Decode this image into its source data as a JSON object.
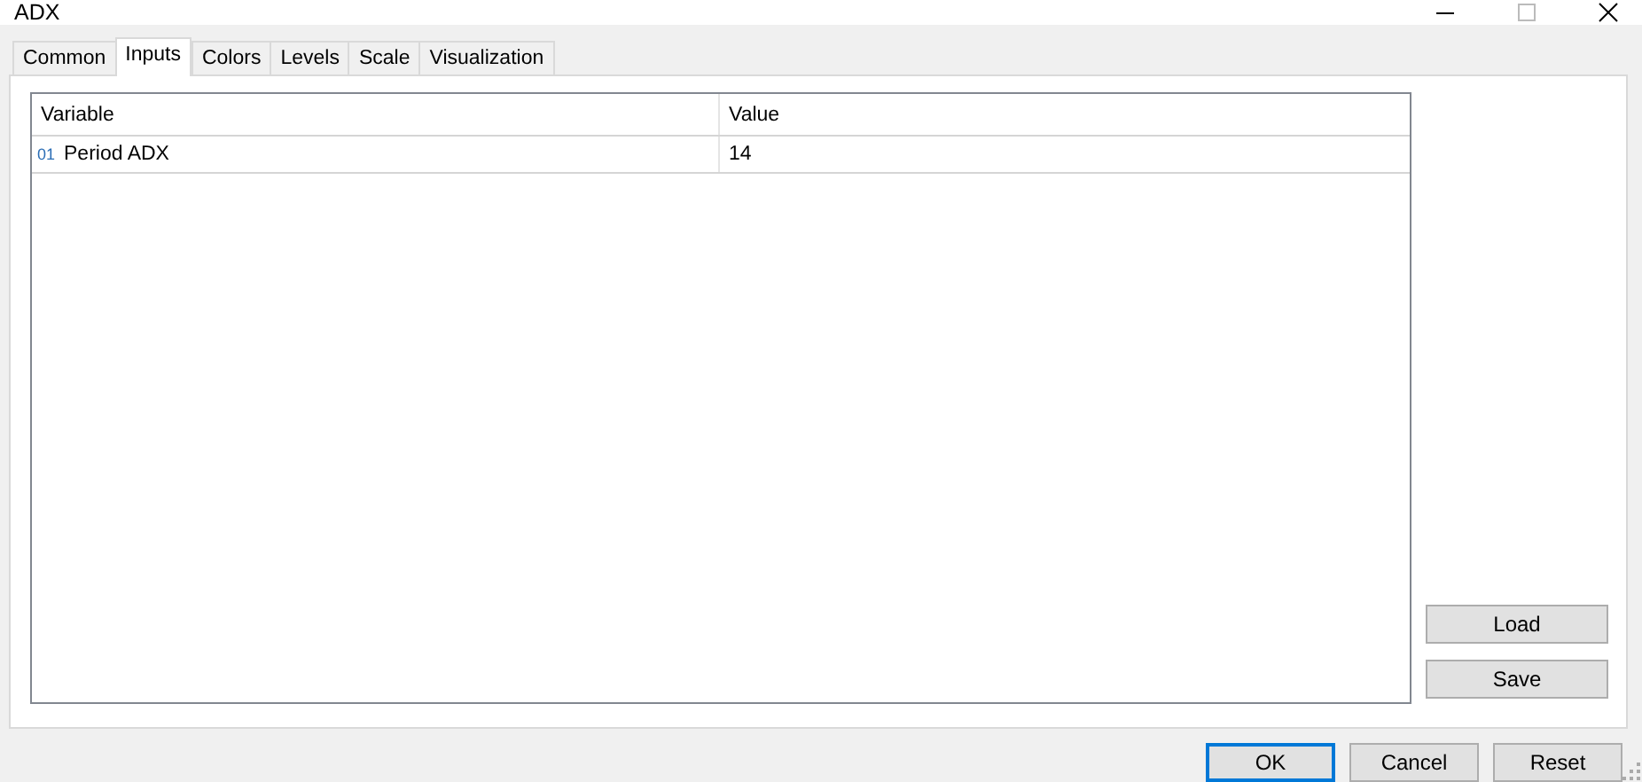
{
  "window": {
    "title": "ADX"
  },
  "tabs": [
    {
      "label": "Common",
      "selected": false
    },
    {
      "label": "Inputs",
      "selected": true
    },
    {
      "label": "Colors",
      "selected": false
    },
    {
      "label": "Levels",
      "selected": false
    },
    {
      "label": "Scale",
      "selected": false
    },
    {
      "label": "Visualization",
      "selected": false
    }
  ],
  "table": {
    "columns": [
      "Variable",
      "Value"
    ],
    "rows": [
      {
        "type_mark": "01",
        "variable": "Period ADX",
        "value": "14"
      }
    ]
  },
  "side_buttons": [
    "Load",
    "Save"
  ],
  "buttons": [
    {
      "label": "OK",
      "focused": true
    },
    {
      "label": "Cancel",
      "focused": false
    },
    {
      "label": "Reset",
      "focused": false
    }
  ]
}
